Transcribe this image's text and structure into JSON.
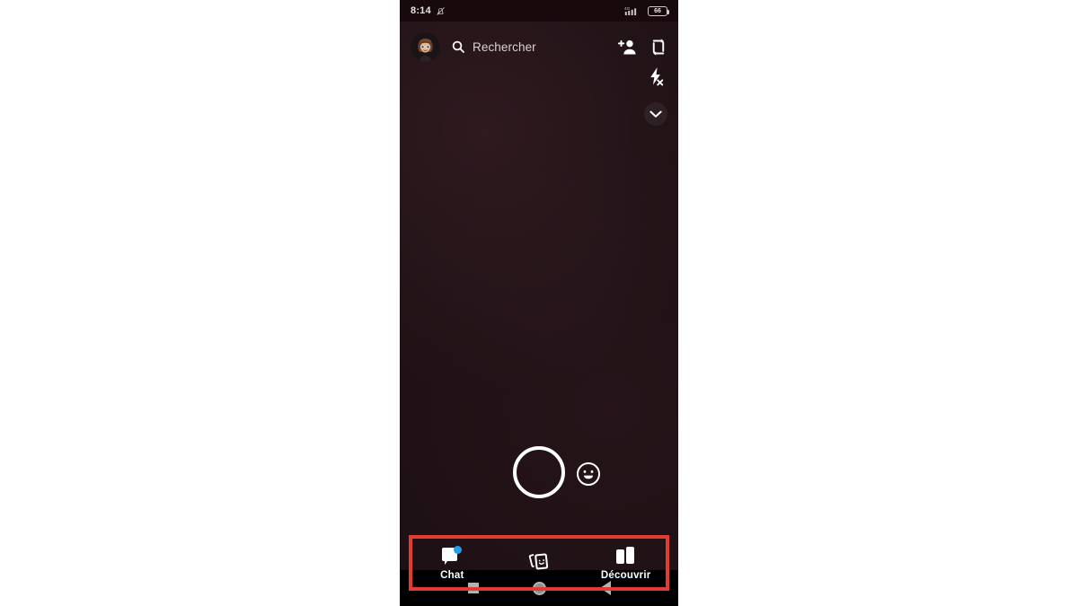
{
  "device": {
    "platform": "android",
    "screen_bg": "#1d1014"
  },
  "status_bar": {
    "time": "8:14",
    "mute_icon": "bell-mute-icon",
    "network_label": "4G",
    "signal_icon": "signal-bars-icon",
    "battery_level": "66",
    "battery_icon": "battery-icon"
  },
  "app_bar": {
    "avatar": {
      "name": "bitmoji-avatar",
      "alt": "bitmoji profile avatar"
    },
    "search": {
      "icon": "search-icon",
      "placeholder": "Rechercher",
      "value": ""
    },
    "add_friend_icon": "add-friend-icon",
    "flip_camera_icon": "flip-camera-icon"
  },
  "camera_rail": {
    "flash_icon": "flash-off-icon",
    "flash_state": "off",
    "expand_icon": "chevron-down-icon"
  },
  "camera_controls": {
    "shutter_icon": "shutter-button",
    "lens_icon": "lens-smiley-icon"
  },
  "bottom_nav": {
    "highlight_color": "#e23b32",
    "badge_color": "#1f9ef2",
    "items": [
      {
        "id": "chat",
        "label": "Chat",
        "icon": "chat-bubble-icon",
        "badge": true,
        "selected": false
      },
      {
        "id": "stories",
        "label": "",
        "icon": "stories-cards-icon",
        "badge": false,
        "selected": false
      },
      {
        "id": "discover",
        "label": "Découvrir",
        "icon": "discover-icon",
        "badge": false,
        "selected": false
      }
    ]
  },
  "android_nav": {
    "recents_icon": "recents-square-icon",
    "home_icon": "home-circle-icon",
    "back_icon": "back-triangle-icon"
  }
}
